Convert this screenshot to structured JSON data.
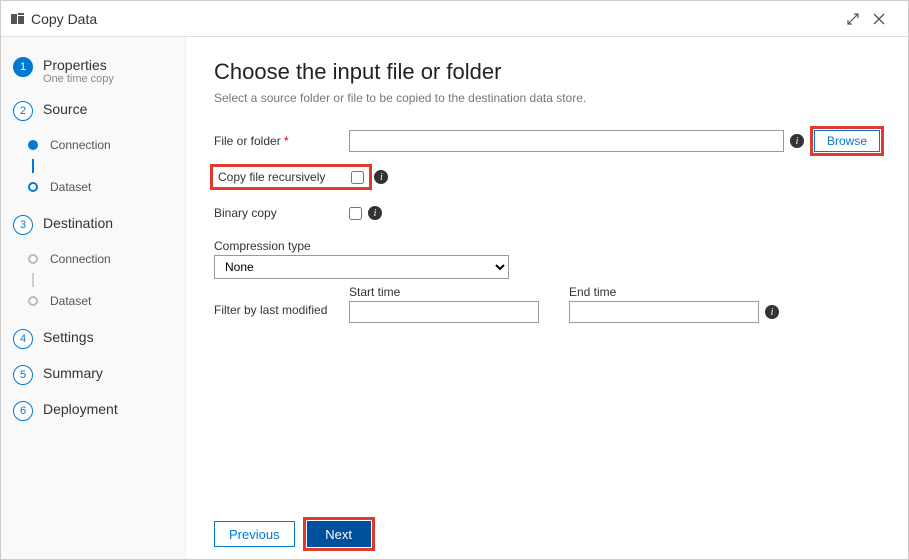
{
  "window": {
    "title": "Copy Data"
  },
  "sidebar": {
    "steps": [
      {
        "num": "1",
        "label": "Properties",
        "sublabel": "One time copy"
      },
      {
        "num": "2",
        "label": "Source"
      },
      {
        "num": "3",
        "label": "Destination"
      },
      {
        "num": "4",
        "label": "Settings"
      },
      {
        "num": "5",
        "label": "Summary"
      },
      {
        "num": "6",
        "label": "Deployment"
      }
    ],
    "source_sub": [
      {
        "label": "Connection"
      },
      {
        "label": "Dataset"
      }
    ],
    "dest_sub": [
      {
        "label": "Connection"
      },
      {
        "label": "Dataset"
      }
    ]
  },
  "main": {
    "heading": "Choose the input file or folder",
    "subtitle": "Select a source folder or file to be copied to the destination data store.",
    "labels": {
      "file_or_folder": "File or folder",
      "browse": "Browse",
      "copy_recursively": "Copy file recursively",
      "binary_copy": "Binary copy",
      "compression_type": "Compression type",
      "start_time": "Start time",
      "end_time": "End time",
      "filter_modified": "Filter by last modified"
    },
    "values": {
      "file_or_folder": "",
      "copy_recursively_checked": false,
      "binary_copy_checked": false,
      "compression_options": [
        "None"
      ],
      "compression_selected": "None",
      "start_time": "",
      "end_time": ""
    }
  },
  "footer": {
    "previous": "Previous",
    "next": "Next"
  }
}
